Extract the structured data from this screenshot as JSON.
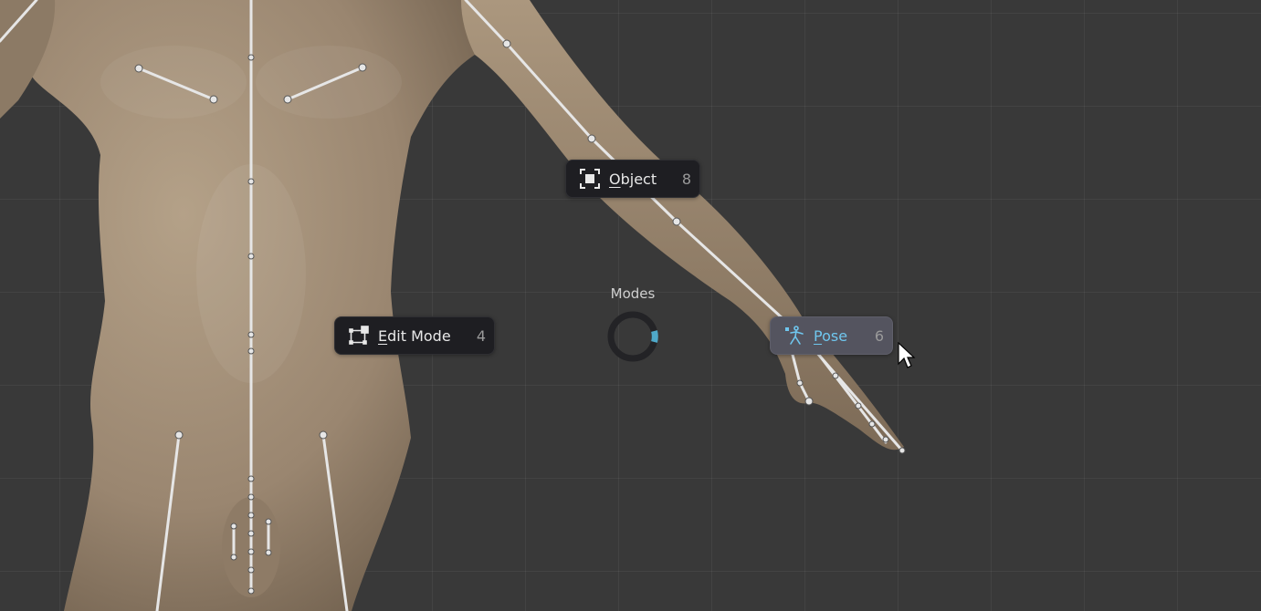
{
  "pie_menu": {
    "title": "Modes",
    "items": [
      {
        "label_first": "O",
        "label_rest": "bject",
        "hotkey": "8",
        "icon": "object-icon"
      },
      {
        "label_first": "E",
        "label_rest": "dit Mode",
        "hotkey": "4",
        "icon": "edit-mode-icon"
      },
      {
        "label_first": "P",
        "label_rest": "ose",
        "hotkey": "6",
        "icon": "pose-icon",
        "active": true
      }
    ],
    "accent_color": "#4fa9c9"
  },
  "colors": {
    "viewport_bg": "#393939",
    "skin": "#9a8670",
    "bone": "#e6e6e6"
  }
}
